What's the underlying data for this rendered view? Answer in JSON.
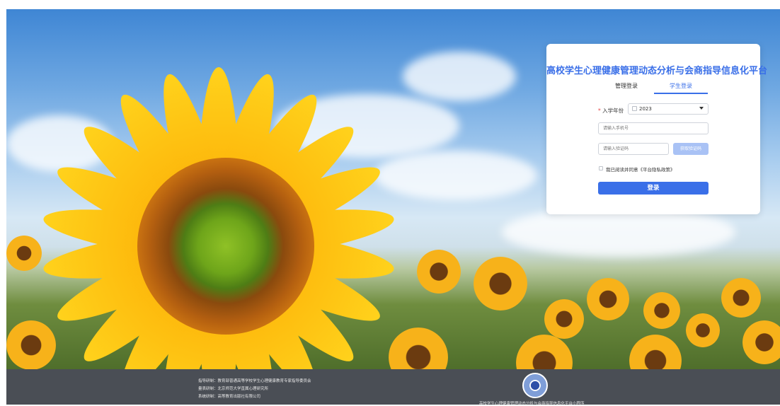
{
  "login": {
    "title": "高校学生心理健康管理动态分析与会商指导信息化平台",
    "tabs": [
      {
        "label": "管理登录",
        "active": false
      },
      {
        "label": "学生登录",
        "active": true
      }
    ],
    "year_label": "入学年份",
    "year_required_mark": "*",
    "year_value": "2023",
    "phone_placeholder": "请输入手机号",
    "code_placeholder": "请输入验证码",
    "code_button": "获取验证码",
    "agree_text": "我已阅读并同意《平台隐私政策》",
    "login_button": "登录"
  },
  "footer": {
    "credits": [
      "指导研制：教育部普通高等学校学生心理健康教育专家指导委员会",
      "量表研制：北京师范大学直属心理研究所",
      "系统研制：高等教育出版社有限公司"
    ],
    "qr_caption": "高校学生心理健康管理动态分析与会商指导信息化平台小程序"
  },
  "colors": {
    "accent": "#3a6fe8",
    "footer_bg": "#4a4e55",
    "code_button_bg": "#a9c2f5"
  },
  "icons": {
    "calendar": "calendar-icon",
    "dropdown": "chevron-down-icon",
    "qr": "qr-code-icon"
  }
}
